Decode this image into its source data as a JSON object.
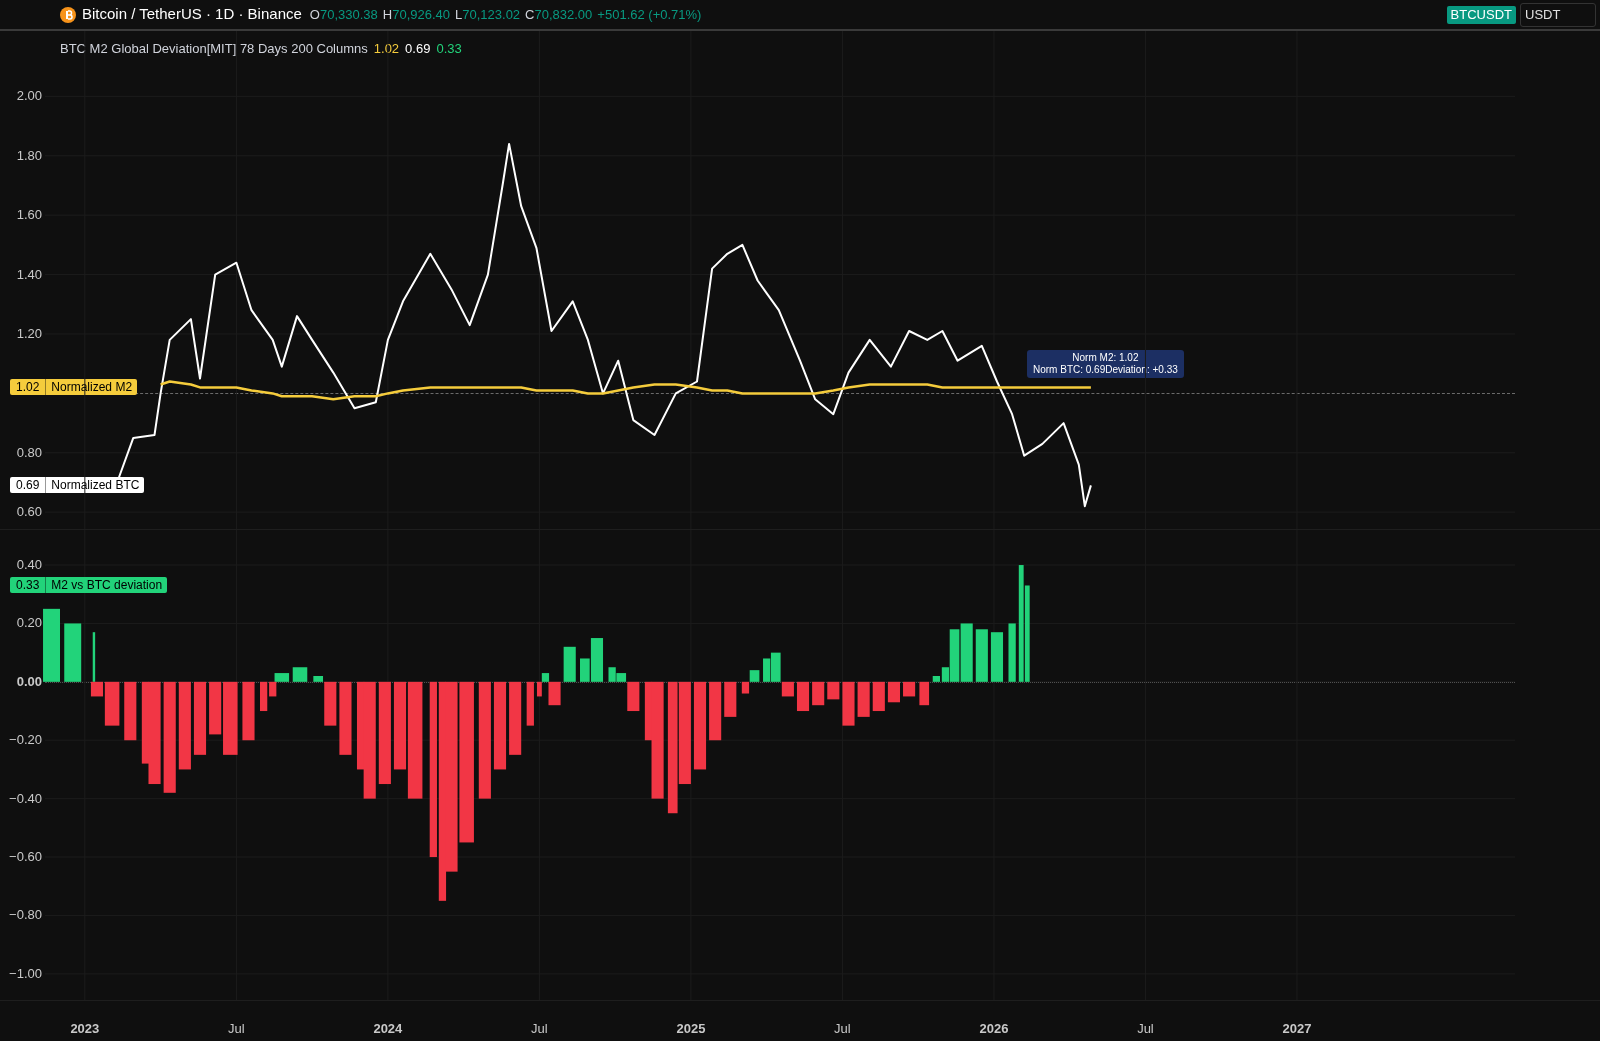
{
  "header": {
    "symbol_title": "Bitcoin / TetherUS · 1D · Binance",
    "ohlc": [
      {
        "label": "O",
        "value": "70,330.38"
      },
      {
        "label": "H",
        "value": "70,926.40"
      },
      {
        "label": "L",
        "value": "70,123.02"
      },
      {
        "label": "C",
        "value": "70,832.00"
      }
    ],
    "change": "+501.62 (+0.71%)",
    "symbol_badge": "BTCUSDT",
    "currency": "USDT"
  },
  "indicator": {
    "title": "BTC M2 Global Deviation[MIT] 78 Days 200 Columns",
    "values": [
      {
        "text": "1.02",
        "color": "#f5cc3c"
      },
      {
        "text": "0.69",
        "color": "#ffffff"
      },
      {
        "text": "0.33",
        "color": "#22d37a"
      }
    ]
  },
  "price_pane": {
    "chart_data": {
      "type": "line",
      "grid": true,
      "xlim": [
        2022.72,
        2028.0
      ],
      "ylim": [
        0.54,
        2.22
      ],
      "yticks": [
        {
          "value": 0.6,
          "label": "0.60"
        },
        {
          "value": 0.8,
          "label": "0.80"
        },
        {
          "value": 1.2,
          "label": "1.20"
        },
        {
          "value": 1.4,
          "label": "1.40"
        },
        {
          "value": 1.6,
          "label": "1.60"
        },
        {
          "value": 1.8,
          "label": "1.80"
        },
        {
          "value": 2.0,
          "label": "2.00"
        }
      ],
      "x": [
        2023.11,
        2023.16,
        2023.23,
        2023.25,
        2023.28,
        2023.35,
        2023.38,
        2023.43,
        2023.5,
        2023.55,
        2023.62,
        2023.65,
        2023.7,
        2023.75,
        2023.82,
        2023.89,
        2023.96,
        2024.0,
        2024.05,
        2024.14,
        2024.21,
        2024.27,
        2024.33,
        2024.38,
        2024.4,
        2024.44,
        2024.49,
        2024.54,
        2024.61,
        2024.66,
        2024.71,
        2024.76,
        2024.81,
        2024.88,
        2024.95,
        2025.02,
        2025.07,
        2025.12,
        2025.17,
        2025.22,
        2025.29,
        2025.36,
        2025.41,
        2025.47,
        2025.52,
        2025.59,
        2025.66,
        2025.72,
        2025.78,
        2025.83,
        2025.88,
        2025.96,
        2026.01,
        2026.06,
        2026.1,
        2026.16,
        2026.23,
        2026.28,
        2026.3,
        2026.32
      ],
      "series": [
        {
          "name": "Normalized M2",
          "color": "#f5cc3c",
          "values": [
            null,
            null,
            null,
            1.03,
            1.04,
            1.03,
            1.02,
            1.02,
            1.02,
            1.01,
            1.0,
            0.99,
            0.99,
            0.99,
            0.98,
            0.99,
            0.99,
            1.0,
            1.01,
            1.02,
            1.02,
            1.02,
            1.02,
            1.02,
            1.02,
            1.02,
            1.01,
            1.01,
            1.01,
            1.0,
            1.0,
            1.01,
            1.02,
            1.03,
            1.03,
            1.02,
            1.01,
            1.01,
            1.0,
            1.0,
            1.0,
            1.0,
            1.0,
            1.01,
            1.02,
            1.03,
            1.03,
            1.03,
            1.03,
            1.02,
            1.02,
            1.02,
            1.02,
            1.02,
            1.02,
            1.02,
            1.02,
            1.02,
            1.02,
            1.02
          ]
        },
        {
          "name": "Normalized BTC",
          "color": "#ffffff",
          "values": [
            0.71,
            0.85,
            0.86,
            1.0,
            1.18,
            1.25,
            1.05,
            1.4,
            1.44,
            1.28,
            1.18,
            1.09,
            1.26,
            1.18,
            1.07,
            0.95,
            0.97,
            1.18,
            1.31,
            1.47,
            1.35,
            1.23,
            1.4,
            1.71,
            1.84,
            1.63,
            1.49,
            1.21,
            1.31,
            1.18,
            1.0,
            1.11,
            0.91,
            0.86,
            1.0,
            1.04,
            1.42,
            1.47,
            1.5,
            1.38,
            1.28,
            1.11,
            0.98,
            0.93,
            1.07,
            1.18,
            1.09,
            1.21,
            1.18,
            1.21,
            1.11,
            1.16,
            1.04,
            0.93,
            0.79,
            0.83,
            0.9,
            0.76,
            0.62,
            0.69
          ]
        }
      ]
    },
    "axis_labels": [
      {
        "value": "1.02"
      },
      {
        "value": "0.69"
      }
    ],
    "tooltip": {
      "lines": [
        "Norm M2: 1.02",
        "Norm BTC: 0.69Deviation: +0.33"
      ]
    }
  },
  "deviation_pane": {
    "chart_data": {
      "type": "bar",
      "grid": true,
      "xlim": [
        2022.72,
        2028.0
      ],
      "ylim": [
        -1.23,
        0.52
      ],
      "stacked": true,
      "yticks": [
        {
          "value": 0.4,
          "label": "0.40"
        },
        {
          "value": 0.2,
          "label": "0.20"
        },
        {
          "value": 0.0,
          "label": "0.00"
        },
        {
          "value": -0.2,
          "label": "−0.20"
        },
        {
          "value": -0.4,
          "label": "−0.40"
        },
        {
          "value": -0.6,
          "label": "−0.60"
        },
        {
          "value": -0.8,
          "label": "−0.80"
        },
        {
          "value": -1.0,
          "label": "−1.00"
        }
      ],
      "xticks": [
        {
          "value": 2023,
          "label": "2023"
        },
        {
          "value": 2023.5,
          "label": "Jul"
        },
        {
          "value": 2024,
          "label": "2024"
        },
        {
          "value": 2024.5,
          "label": "Jul"
        },
        {
          "value": 2025,
          "label": "2025"
        },
        {
          "value": 2025.5,
          "label": "Jul"
        },
        {
          "value": 2026,
          "label": "2026"
        },
        {
          "value": 2026.5,
          "label": "Jul"
        },
        {
          "value": 2027,
          "label": "2027"
        }
      ],
      "x": [
        2022.89,
        2022.96,
        2023.03,
        2023.04,
        2023.09,
        2023.15,
        2023.2,
        2023.23,
        2023.28,
        2023.33,
        2023.38,
        2023.43,
        2023.48,
        2023.54,
        2023.59,
        2023.62,
        2023.65,
        2023.71,
        2023.77,
        2023.81,
        2023.86,
        2023.91,
        2023.94,
        2023.99,
        2024.04,
        2024.09,
        2024.15,
        2024.18,
        2024.21,
        2024.26,
        2024.32,
        2024.37,
        2024.42,
        2024.47,
        2024.5,
        2024.52,
        2024.55,
        2024.6,
        2024.65,
        2024.69,
        2024.74,
        2024.77,
        2024.81,
        2024.86,
        2024.89,
        2024.94,
        2024.98,
        2025.03,
        2025.08,
        2025.13,
        2025.18,
        2025.21,
        2025.25,
        2025.28,
        2025.32,
        2025.37,
        2025.42,
        2025.47,
        2025.52,
        2025.57,
        2025.62,
        2025.67,
        2025.72,
        2025.77,
        2025.81,
        2025.84,
        2025.87,
        2025.91,
        2025.96,
        2026.01,
        2026.06,
        2026.09,
        2026.11
      ],
      "series": [
        {
          "name": "M2 vs BTC deviation",
          "color": "#22d37a",
          "values": [
            0.25,
            0.2,
            0.17,
            null,
            null,
            null,
            null,
            null,
            null,
            null,
            null,
            null,
            null,
            null,
            null,
            null,
            0.03,
            0.05,
            0.02,
            null,
            null,
            null,
            null,
            null,
            null,
            null,
            null,
            null,
            null,
            null,
            null,
            null,
            null,
            null,
            null,
            0.03,
            null,
            0.12,
            0.08,
            0.15,
            0.05,
            0.03,
            null,
            null,
            null,
            null,
            null,
            null,
            null,
            null,
            null,
            0.04,
            0.08,
            0.1,
            null,
            null,
            null,
            null,
            null,
            null,
            null,
            null,
            null,
            null,
            0.02,
            0.05,
            0.18,
            0.2,
            0.18,
            0.17,
            0.2,
            0.4,
            0.33
          ]
        },
        {
          "color": "#f23645",
          "values": [
            null,
            null,
            null,
            -0.05,
            -0.15,
            -0.2,
            -0.28,
            -0.35,
            -0.38,
            -0.3,
            -0.25,
            -0.18,
            -0.25,
            -0.2,
            -0.1,
            -0.05,
            null,
            null,
            null,
            -0.15,
            -0.25,
            -0.3,
            -0.4,
            -0.35,
            -0.3,
            -0.4,
            -0.6,
            -0.75,
            -0.65,
            -0.55,
            -0.4,
            -0.3,
            -0.25,
            -0.15,
            -0.05,
            null,
            -0.08,
            null,
            null,
            null,
            null,
            null,
            -0.1,
            -0.2,
            -0.4,
            -0.45,
            -0.35,
            -0.3,
            -0.2,
            -0.12,
            -0.04,
            null,
            null,
            null,
            -0.05,
            -0.1,
            -0.08,
            -0.06,
            -0.15,
            -0.12,
            -0.1,
            -0.07,
            -0.05,
            -0.08,
            null,
            null,
            null,
            null,
            null,
            null,
            null,
            null,
            null
          ]
        }
      ]
    },
    "axis_label": {
      "value": "0.33"
    }
  }
}
